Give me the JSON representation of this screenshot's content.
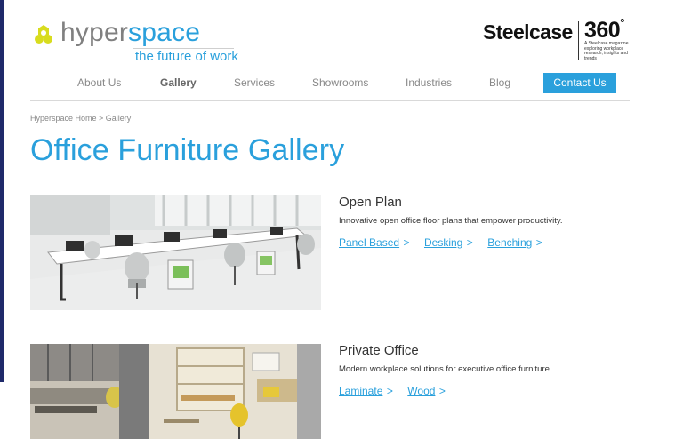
{
  "header": {
    "brand_part1": "hyper",
    "brand_part2": "space",
    "tagline": "the future of work",
    "partner_name": "Steelcase",
    "partner_360": "360",
    "partner_degree": "°",
    "partner_caption": "A Steelcase magazine exploring workplace research, insights and trends"
  },
  "nav": {
    "items": [
      {
        "label": "About Us"
      },
      {
        "label": "Gallery"
      },
      {
        "label": "Services"
      },
      {
        "label": "Showrooms"
      },
      {
        "label": "Industries"
      },
      {
        "label": "Blog"
      }
    ],
    "contact_label": "Contact Us",
    "active": "Gallery"
  },
  "breadcrumb": "Hyperspace Home > Gallery",
  "page_title": "Office Furniture Gallery",
  "sections": [
    {
      "title": "Open Plan",
      "description": "Innovative open office floor plans that empower productivity.",
      "links": [
        {
          "label": "Panel Based",
          "arrow": ">"
        },
        {
          "label": "Desking",
          "arrow": ">"
        },
        {
          "label": "Benching",
          "arrow": ">"
        }
      ]
    },
    {
      "title": "Private Office",
      "description": "Modern workplace solutions for executive office furniture.",
      "links": [
        {
          "label": "Laminate",
          "arrow": ">"
        },
        {
          "label": "Wood",
          "arrow": ">"
        }
      ]
    }
  ],
  "colors": {
    "accent": "#2aa0dc",
    "logo_yellow": "#d8dc1e",
    "nav_text": "#888888",
    "left_bar": "#1f2a6a"
  },
  "icons": [
    "hyperspace-logo-icon",
    "open-plan-photo",
    "private-office-photo"
  ]
}
